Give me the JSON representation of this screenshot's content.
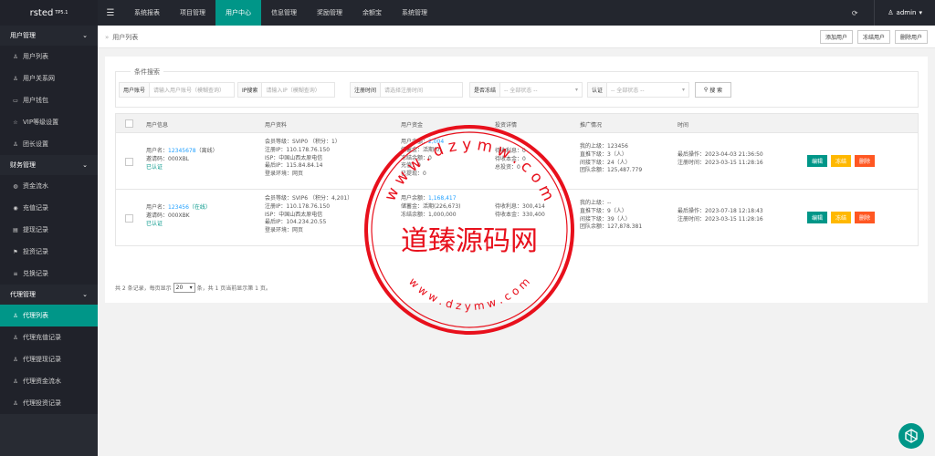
{
  "app": {
    "logo": "rsted",
    "version": "TP5.1"
  },
  "topnav": [
    "系统报表",
    "项目管理",
    "用户中心",
    "信息管理",
    "奖励管理",
    "余额宝",
    "系统管理"
  ],
  "topnav_active": 2,
  "user": {
    "name": "admin"
  },
  "sidebar": [
    {
      "title": "用户管理",
      "items": [
        {
          "label": "用户列表",
          "icon": "user-icon"
        },
        {
          "label": "用户关系网",
          "icon": "users-icon"
        },
        {
          "label": "用户钱包",
          "icon": "wallet-icon"
        },
        {
          "label": "VIP等级设置",
          "icon": "star-icon"
        },
        {
          "label": "团长设置",
          "icon": "leader-icon"
        }
      ]
    },
    {
      "title": "财务管理",
      "items": [
        {
          "label": "资金流水",
          "icon": "coin-icon"
        },
        {
          "label": "充值记录",
          "icon": "recharge-icon"
        },
        {
          "label": "提现记录",
          "icon": "withdraw-icon"
        },
        {
          "label": "投资记录",
          "icon": "flag-icon"
        },
        {
          "label": "兑换记录",
          "icon": "list-icon"
        }
      ]
    },
    {
      "title": "代理管理",
      "items": [
        {
          "label": "代理列表",
          "icon": "user-icon"
        },
        {
          "label": "代理充值记录",
          "icon": "user-icon"
        },
        {
          "label": "代理提现记录",
          "icon": "user-icon"
        },
        {
          "label": "代理资金流水",
          "icon": "user-icon"
        },
        {
          "label": "代理投资记录",
          "icon": "user-icon"
        }
      ]
    }
  ],
  "sidebar_active": "代理列表",
  "breadcrumb": "用户列表",
  "actions": [
    "添加用户",
    "冻结用户",
    "删除用户"
  ],
  "search": {
    "legend": "条件搜索",
    "account_label": "用户账号",
    "account_placeholder": "请输入用户账号（模糊查询）",
    "ip_label": "IP搜索",
    "ip_placeholder": "请输入IP（模糊查询）",
    "time_label": "注册时间",
    "time_placeholder": "请选择注册时间",
    "frozen_label": "是否冻结",
    "frozen_value": "-- 全部状态 --",
    "auth_label": "认证",
    "auth_value": "-- 全部状态 --",
    "button": "搜 索"
  },
  "table": {
    "headers": [
      "用户信息",
      "用户资料",
      "用户资金",
      "投资详情",
      "推广情况",
      "时间"
    ],
    "rows": [
      {
        "uname_label": "用户名：",
        "uname": "12345678",
        "status": "（离线）",
        "invite": "邀请码：000XBL",
        "auth": "已认证",
        "profile": [
          "会员等级：SVIP0 （积分：1）",
          "注册IP：110.178.76.150",
          "ISP：中国山西太原电信",
          "最后IP：115.84.84.14",
          "登录环境：网页"
        ],
        "balance_label": "用户余额：",
        "balance": "2,004",
        "funds": [
          "储蓄金：活期(0)",
          "冻结余额：0",
          "充值：0",
          "已提现：0"
        ],
        "invest": [
          "待收利息：0",
          "待收本金：0",
          "总投资：0"
        ],
        "promo": [
          "我的上级：123456",
          "直推下级：3（人）",
          "间接下级：24（人）",
          "团队余额：125,487.779"
        ],
        "time": [
          "最后操作：2023-04-03 21:36:50",
          "注册时间：2023-03-15 11:28:16"
        ]
      },
      {
        "uname_label": "用户名：",
        "uname": "123456",
        "status": "（在线）",
        "invite": "邀请码：000XBK",
        "auth": "已认证",
        "profile": [
          "会员等级：SVIP6 （积分：4,201）",
          "注册IP：110.178.76.150",
          "ISP：中国山西太原电信",
          "最后IP：104.234.20.55",
          "登录环境：网页"
        ],
        "balance_label": "用户余额：",
        "balance": "1,168,417",
        "funds": [
          "储蓄金：活期(226,673)",
          "冻结余额：1,000,000"
        ],
        "invest": [
          "待收利息：300,414",
          "待收本金：330,400"
        ],
        "promo": [
          "我的上级：--",
          "直推下级：9（人）",
          "间接下级：39（人）",
          "团队余额：127,878.381"
        ],
        "time": [
          "最后操作：2023-07-18 12:18:43",
          "注册时间：2023-03-15 11:28:16"
        ]
      }
    ],
    "op_labels": [
      "编辑",
      "冻结",
      "删除"
    ]
  },
  "pager": {
    "prefix": "共 2 条记录，每页显示",
    "per_page": "20",
    "suffix": "条，共 1 页当前显示第 1 页。"
  },
  "watermark": {
    "url_top": "w w w . d z y m w . c o m",
    "url_bottom": "w w w . d z y m w . c o m",
    "name": "道臻源码网"
  },
  "colors": {
    "accent": "#009688",
    "dark": "#23262e",
    "side": "#282b33",
    "link": "#1e9fff",
    "warn": "#ffb800",
    "danger": "#ff5722",
    "stamp": "#e8101c"
  }
}
